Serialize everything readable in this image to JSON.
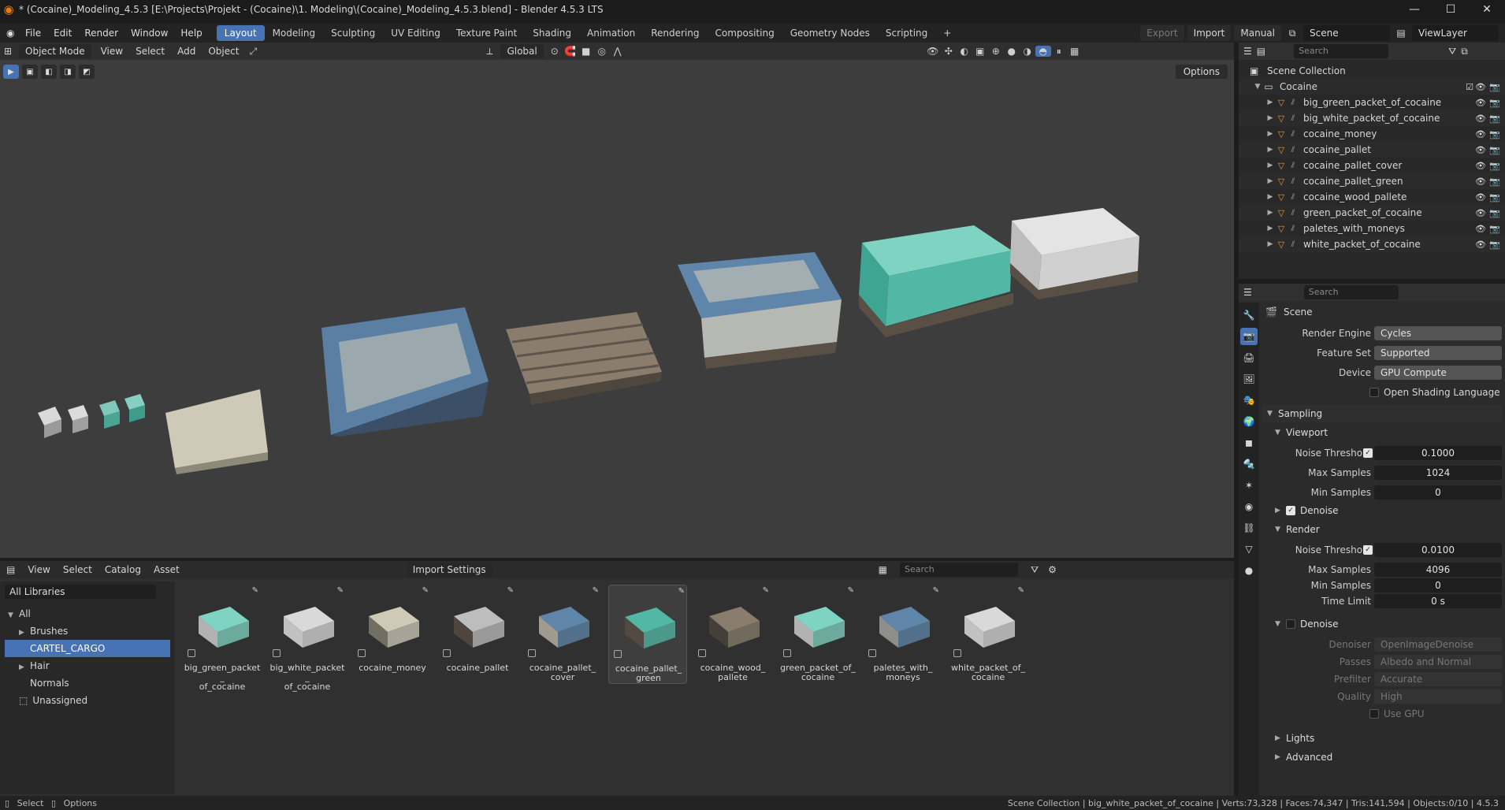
{
  "window": {
    "title": "* (Cocaine)_Modeling_4.5.3 [E:\\Projects\\Projekt - (Cocaine)\\1. Modeling\\(Cocaine)_Modeling_4.5.3.blend] - Blender 4.5.3 LTS",
    "minimize": "—",
    "maximize": "☐",
    "close": "✕"
  },
  "menu": [
    "File",
    "Edit",
    "Render",
    "Window",
    "Help"
  ],
  "workspaces": [
    "Layout",
    "Modeling",
    "Sculpting",
    "UV Editing",
    "Texture Paint",
    "Shading",
    "Animation",
    "Rendering",
    "Compositing",
    "Geometry Nodes",
    "Scripting"
  ],
  "active_workspace": "Layout",
  "topright": {
    "export": "Export",
    "import": "Import",
    "manual": "Manual",
    "scene": "Scene",
    "viewlayer": "ViewLayer"
  },
  "viewport": {
    "mode": "Object Mode",
    "menus": [
      "View",
      "Select",
      "Add",
      "Object"
    ],
    "orientation": "Global",
    "options": "Options"
  },
  "outliner": {
    "search_placeholder": "Search",
    "root": "Scene Collection",
    "collection": "Cocaine",
    "objects": [
      "big_green_packet_of_cocaine",
      "big_white_packet_of_cocaine",
      "cocaine_money",
      "cocaine_pallet",
      "cocaine_pallet_cover",
      "cocaine_pallet_green",
      "cocaine_wood_pallete",
      "green_packet_of_cocaine",
      "paletes_with_moneys",
      "white_packet_of_cocaine"
    ]
  },
  "properties": {
    "search_placeholder": "Search",
    "context": "Scene",
    "render_engine_label": "Render Engine",
    "render_engine": "Cycles",
    "feature_set_label": "Feature Set",
    "feature_set": "Supported",
    "device_label": "Device",
    "device": "GPU Compute",
    "osl_label": "Open Shading Language",
    "sampling": "Sampling",
    "viewport_sub": "Viewport",
    "noise_threshold_label": "Noise Threshold",
    "vp_noise_threshold": "0.1000",
    "max_samples_label": "Max Samples",
    "vp_max_samples": "1024",
    "min_samples_label": "Min Samples",
    "vp_min_samples": "0",
    "denoise_label": "Denoise",
    "render_sub": "Render",
    "r_noise_threshold": "0.0100",
    "r_max_samples": "4096",
    "r_min_samples": "0",
    "time_limit_label": "Time Limit",
    "r_time_limit": "0 s",
    "denoiser_label": "Denoiser",
    "denoiser": "OpenImageDenoise",
    "passes_label": "Passes",
    "passes": "Albedo and Normal",
    "prefilter_label": "Prefilter",
    "prefilter": "Accurate",
    "quality_label": "Quality",
    "quality": "High",
    "use_gpu_label": "Use GPU",
    "lights": "Lights",
    "advanced": "Advanced"
  },
  "asset_browser": {
    "menus": [
      "View",
      "Select",
      "Catalog",
      "Asset"
    ],
    "import_settings": "Import Settings",
    "search_placeholder": "Search",
    "library": "All Libraries",
    "catalogs": {
      "all": "All",
      "brushes": "Brushes",
      "cargo": "CARTEL_CARGO",
      "hair": "Hair",
      "normals": "Normals",
      "unassigned": "Unassigned"
    },
    "assets": [
      {
        "name": "big_green_packet_of_cocaine",
        "label": "big_green_packet_\nof_cocaine"
      },
      {
        "name": "big_white_packet_of_cocaine",
        "label": "big_white_packet_\nof_cocaine"
      },
      {
        "name": "cocaine_money",
        "label": "cocaine_money"
      },
      {
        "name": "cocaine_pallet",
        "label": "cocaine_pallet"
      },
      {
        "name": "cocaine_pallet_cover",
        "label": "cocaine_pallet_\ncover"
      },
      {
        "name": "cocaine_pallet_green",
        "label": "cocaine_pallet_\ngreen"
      },
      {
        "name": "cocaine_wood_pallete",
        "label": "cocaine_wood_\npallete"
      },
      {
        "name": "green_packet_of_cocaine",
        "label": "green_packet_of_\ncocaine"
      },
      {
        "name": "paletes_with_moneys",
        "label": "paletes_with_\nmoneys"
      },
      {
        "name": "white_packet_of_cocaine",
        "label": "white_packet_of_\ncocaine"
      }
    ]
  },
  "status": {
    "select": "Select",
    "options": "Options",
    "stats": "Scene Collection | big_white_packet_of_cocaine | Verts:73,328 | Faces:74,347 | Tris:141,594 | Objects:0/10 | 4.5.3"
  },
  "colors": {
    "accent": "#4772b3",
    "object_orange": "#e8913a",
    "mesh_green": "#5fd0a0"
  }
}
